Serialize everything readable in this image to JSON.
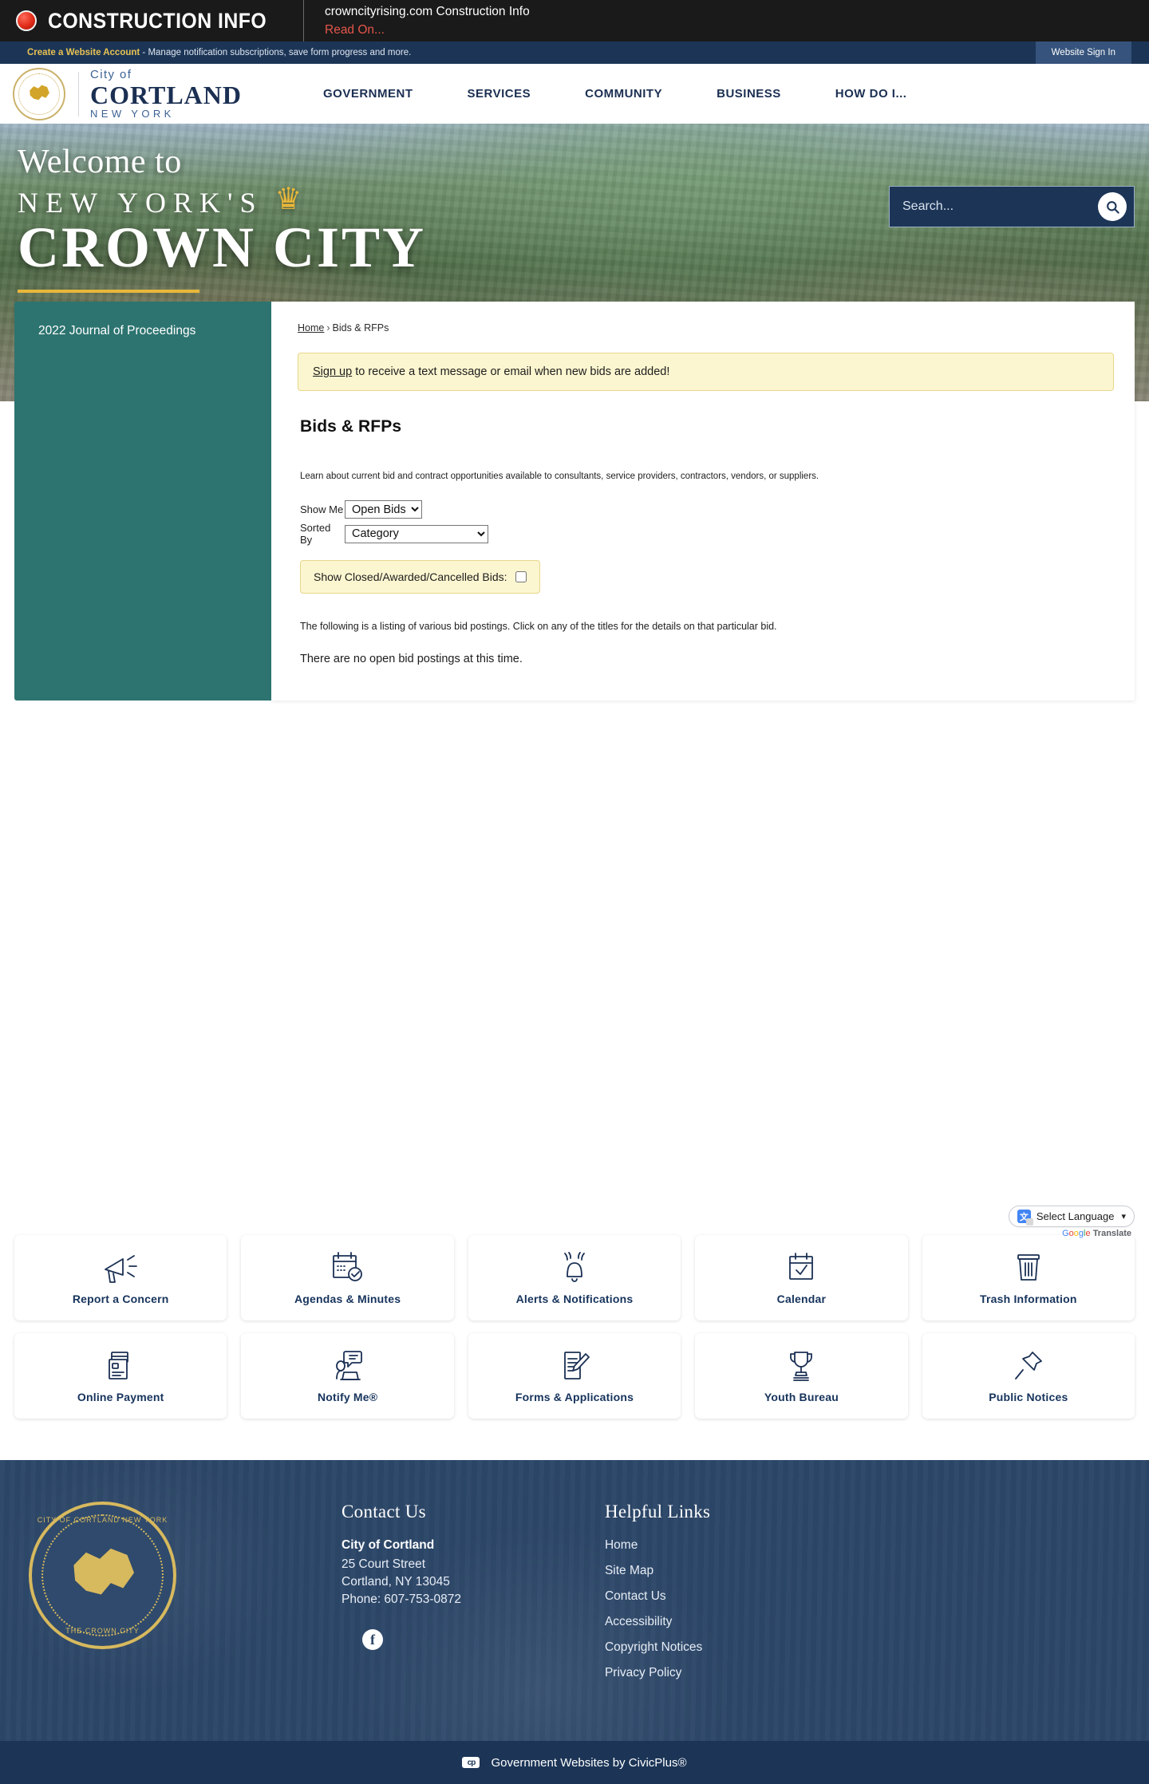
{
  "alert": {
    "title": "CONSTRUCTION INFO",
    "message": "crowncityrising.com Construction Info",
    "read_on": "Read On..."
  },
  "account_strip": {
    "link": "Create a Website Account",
    "text": " - Manage notification subscriptions, save form progress and more.",
    "signin": "Website Sign In"
  },
  "brand": {
    "city_of": "City of",
    "name": "CORTLAND",
    "state": "NEW YORK"
  },
  "nav": {
    "items": [
      {
        "label": "GOVERNMENT"
      },
      {
        "label": "SERVICES"
      },
      {
        "label": "COMMUNITY"
      },
      {
        "label": "BUSINESS"
      },
      {
        "label": "HOW DO I..."
      }
    ]
  },
  "hero": {
    "welcome": "Welcome to",
    "nys": "NEW YORK'S",
    "crown": "CROWN CITY"
  },
  "search": {
    "placeholder": "Search...",
    "value": ""
  },
  "sidebar": {
    "items": [
      {
        "label": "2022 Journal of Proceedings"
      }
    ]
  },
  "breadcrumb": {
    "home": "Home",
    "separator": "›",
    "current": "Bids & RFPs"
  },
  "notice": {
    "link": "Sign up",
    "text": " to receive a text message or email when new bids are added!"
  },
  "main": {
    "title": "Bids & RFPs",
    "lede": "Learn about current bid and contract opportunities available to consultants, service providers, contractors, vendors, or suppliers.",
    "show_me_label": "Show Me",
    "show_me_value": "Open Bids",
    "show_me_options": [
      "Open Bids"
    ],
    "sorted_by_label": "Sorted By",
    "sorted_by_value": "Category",
    "sorted_by_options": [
      "Category"
    ],
    "closed_label": "Show Closed/Awarded/Cancelled Bids:",
    "closed_checked": false,
    "listing_note": "The following is a listing of various bid postings. Click on any of the titles for the details on that particular bid.",
    "no_bids": "There are no open bid postings at this time."
  },
  "language": {
    "label": "Select Language",
    "chevron": "▾",
    "google": [
      "G",
      "o",
      "o",
      "g",
      "l",
      "e"
    ],
    "translate": "Translate"
  },
  "tiles": {
    "row1": [
      {
        "label": "Report a Concern",
        "icon": "megaphone-icon"
      },
      {
        "label": "Agendas & Minutes",
        "icon": "calendar-check-icon"
      },
      {
        "label": "Alerts & Notifications",
        "icon": "bell-icon"
      },
      {
        "label": "Calendar",
        "icon": "calendar-icon"
      },
      {
        "label": "Trash Information",
        "icon": "trash-icon"
      }
    ],
    "row2": [
      {
        "label": "Online Payment",
        "icon": "credit-card-icon"
      },
      {
        "label": "Notify Me®",
        "icon": "person-laptop-icon"
      },
      {
        "label": "Forms & Applications",
        "icon": "form-pen-icon"
      },
      {
        "label": "Youth Bureau",
        "icon": "trophy-icon"
      },
      {
        "label": "Public Notices",
        "icon": "pushpin-icon"
      }
    ]
  },
  "footer": {
    "seal_top": "CITY OF CORTLAND NEW YORK",
    "seal_bottom": "THE CROWN CITY",
    "contact_head": "Contact Us",
    "org": "City of Cortland",
    "address1": "25 Court Street",
    "address2": "Cortland, NY 13045",
    "phone": "Phone: 607-753-0872",
    "facebook": "f",
    "links_head": "Helpful Links",
    "links": [
      {
        "label": "Home"
      },
      {
        "label": "Site Map"
      },
      {
        "label": "Contact Us"
      },
      {
        "label": "Accessibility"
      },
      {
        "label": "Copyright Notices"
      },
      {
        "label": "Privacy Policy"
      }
    ]
  },
  "civicplus": {
    "text": "Government Websites by CivicPlus®",
    "logo": "cp"
  },
  "colors": {
    "navy": "#1c3557",
    "teal": "#2d7470",
    "gold": "#e8b73b",
    "alert_red": "#e4564a"
  }
}
